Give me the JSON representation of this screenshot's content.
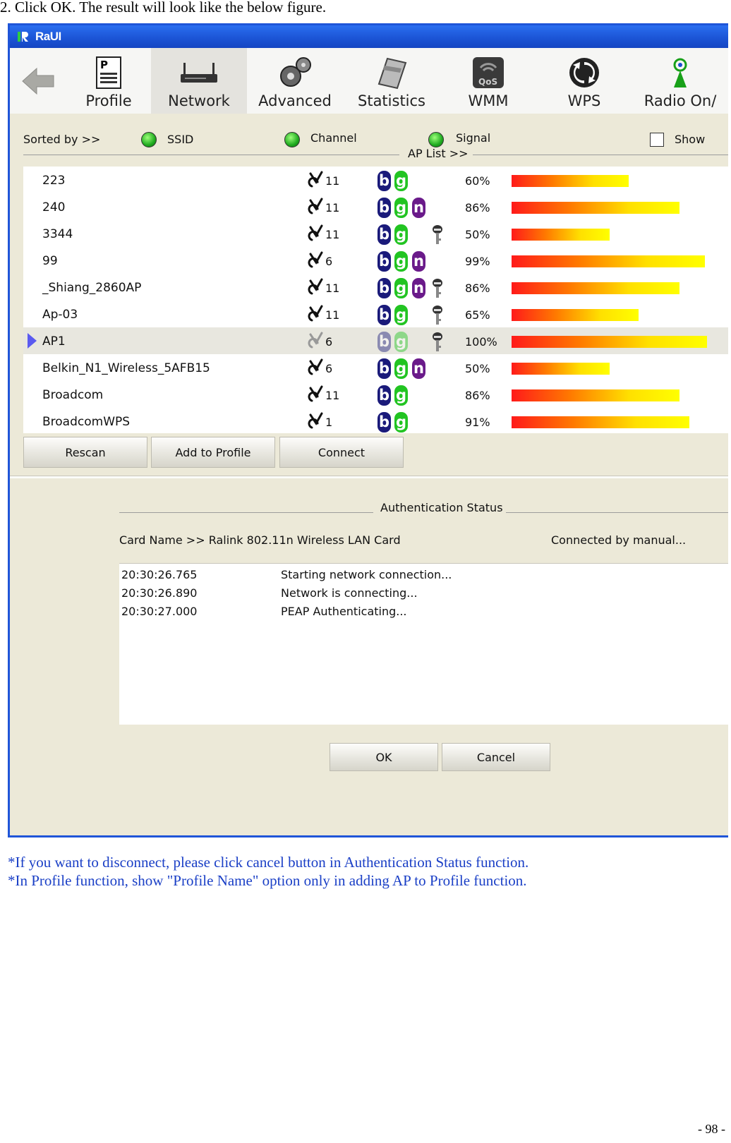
{
  "document": {
    "heading": "2. Click OK. The result will look like the below figure.",
    "footnotes": [
      "*If you want to disconnect, please click cancel button in Authentication Status function.",
      "*In Profile function, show \"Profile Name\" option only in adding AP to Profile function."
    ],
    "page_number": "- 98 -"
  },
  "app": {
    "title": "RaUI",
    "colors": {
      "title_bar": "#1b53d4",
      "selected_row": "#e8e7df",
      "footnote_text": "#1a3fc6"
    },
    "toolbar": [
      {
        "label": "Profile",
        "icon": "profile-icon"
      },
      {
        "label": "Network",
        "icon": "network-icon",
        "active": true
      },
      {
        "label": "Advanced",
        "icon": "gears-icon"
      },
      {
        "label": "Statistics",
        "icon": "calculator-icon"
      },
      {
        "label": "WMM",
        "icon": "qos-icon"
      },
      {
        "label": "WPS",
        "icon": "wps-icon"
      },
      {
        "label": "Radio On/",
        "icon": "radio-antenna-icon"
      }
    ],
    "sort": {
      "label": "Sorted by >>",
      "ssid": "SSID",
      "channel": "Channel",
      "signal": "Signal",
      "show": "Show"
    },
    "ap_list_label": "AP List >>",
    "ap_list": [
      {
        "ssid": "223",
        "channel": "11",
        "b": true,
        "g": true,
        "n": false,
        "lock": false,
        "signal": "60%",
        "signal_value": 60
      },
      {
        "ssid": "240",
        "channel": "11",
        "b": true,
        "g": true,
        "n": true,
        "lock": false,
        "signal": "86%",
        "signal_value": 86
      },
      {
        "ssid": "3344",
        "channel": "11",
        "b": true,
        "g": true,
        "n": false,
        "lock": true,
        "signal": "50%",
        "signal_value": 50
      },
      {
        "ssid": "99",
        "channel": "6",
        "b": true,
        "g": true,
        "n": true,
        "lock": false,
        "signal": "99%",
        "signal_value": 99
      },
      {
        "ssid": "_Shiang_2860AP",
        "channel": "11",
        "b": true,
        "g": true,
        "n": true,
        "lock": true,
        "signal": "86%",
        "signal_value": 86
      },
      {
        "ssid": "Ap-03",
        "channel": "11",
        "b": true,
        "g": true,
        "n": false,
        "lock": true,
        "signal": "65%",
        "signal_value": 65
      },
      {
        "ssid": "AP1",
        "channel": "6",
        "b": true,
        "g": true,
        "n": false,
        "lock": true,
        "signal": "100%",
        "signal_value": 100,
        "selected": true
      },
      {
        "ssid": "Belkin_N1_Wireless_5AFB15",
        "channel": "6",
        "b": true,
        "g": true,
        "n": true,
        "lock": false,
        "signal": "50%",
        "signal_value": 50
      },
      {
        "ssid": "Broadcom",
        "channel": "11",
        "b": true,
        "g": true,
        "n": false,
        "lock": false,
        "signal": "86%",
        "signal_value": 86
      },
      {
        "ssid": "BroadcomWPS",
        "channel": "1",
        "b": true,
        "g": true,
        "n": false,
        "lock": false,
        "signal": "91%",
        "signal_value": 91
      }
    ],
    "badges": {
      "b": "b",
      "g": "g",
      "n": "n"
    },
    "buttons": {
      "rescan": "Rescan",
      "add_to_profile": "Add to Profile",
      "connect": "Connect",
      "ok": "OK",
      "cancel": "Cancel"
    },
    "auth": {
      "title": "Authentication Status",
      "card_name": "Card Name >> Ralink 802.11n Wireless LAN Card",
      "connected_by": "Connected by manual...",
      "log": [
        {
          "time": "20:30:26.765",
          "message": "Starting network connection..."
        },
        {
          "time": "20:30:26.890",
          "message": "Network is connecting..."
        },
        {
          "time": "20:30:27.000",
          "message": "PEAP Authenticating..."
        }
      ]
    }
  }
}
